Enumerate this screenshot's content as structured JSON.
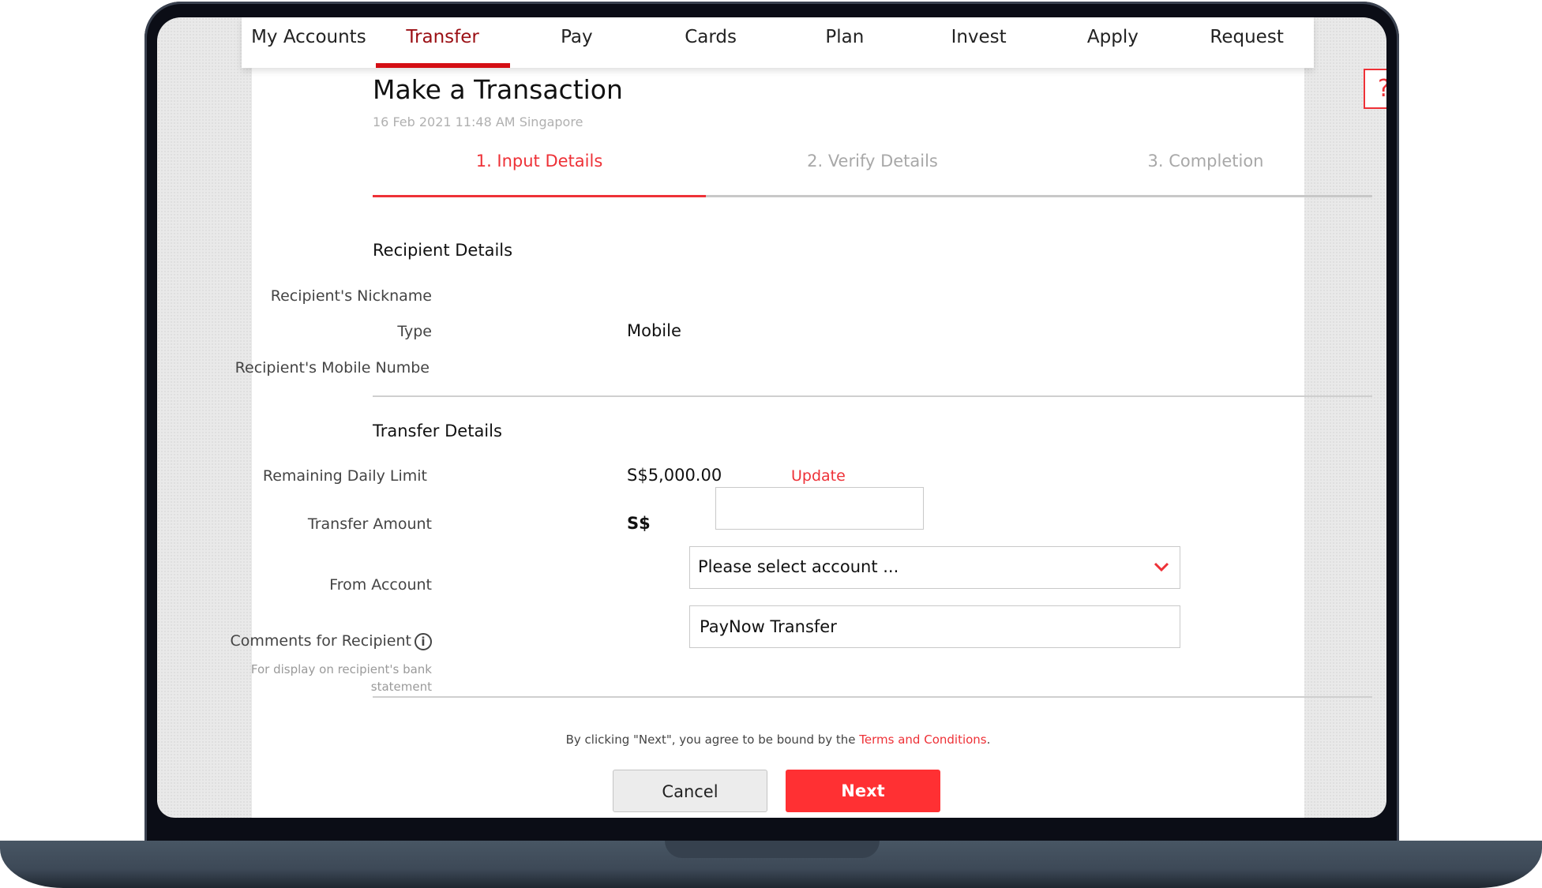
{
  "nav": {
    "items": [
      {
        "label": "My Accounts",
        "active": false
      },
      {
        "label": "Transfer",
        "active": true
      },
      {
        "label": "Pay",
        "active": false
      },
      {
        "label": "Cards",
        "active": false
      },
      {
        "label": "Plan",
        "active": false
      },
      {
        "label": "Invest",
        "active": false
      },
      {
        "label": "Apply",
        "active": false
      },
      {
        "label": "Request",
        "active": false
      }
    ]
  },
  "help": {
    "label": "?"
  },
  "page": {
    "title": "Make a Transaction",
    "datetime": "16 Feb 2021 11:48 AM Singapore"
  },
  "steps": {
    "items": [
      {
        "label": "1. Input Details",
        "active": true
      },
      {
        "label": "2. Verify Details",
        "active": false
      },
      {
        "label": "3. Completion",
        "active": false
      }
    ],
    "progress_fraction": 0.333
  },
  "recipient": {
    "title": "Recipient Details",
    "nickname_label": "Recipient's Nickname",
    "nickname_value": "",
    "type_label": "Type",
    "type_value": "Mobile",
    "mobile_label": "Recipient's Mobile Numbe",
    "mobile_value": ""
  },
  "transfer": {
    "title": "Transfer Details",
    "limit_label": "Remaining Daily Limit",
    "limit_value": "S$5,000.00",
    "update_link": "Update",
    "amount_label": "Transfer Amount",
    "currency": "S$",
    "amount_value": "",
    "from_label": "From Account",
    "from_value": "Please select account ...",
    "comments_label": "Comments for Recipient",
    "comments_value": "PayNow Transfer",
    "comments_helper": "For display on recipient's bank statement",
    "info_glyph": "i"
  },
  "footer": {
    "terms_prefix": "By clicking \"Next\", you agree to be bound by the ",
    "terms_link": "Terms and Conditions",
    "terms_suffix": ".",
    "cancel_label": "Cancel",
    "next_label": "Next"
  },
  "colors": {
    "accent": "#ee3137",
    "nav_active": "#9b0f14",
    "next_button": "#ff3033"
  }
}
